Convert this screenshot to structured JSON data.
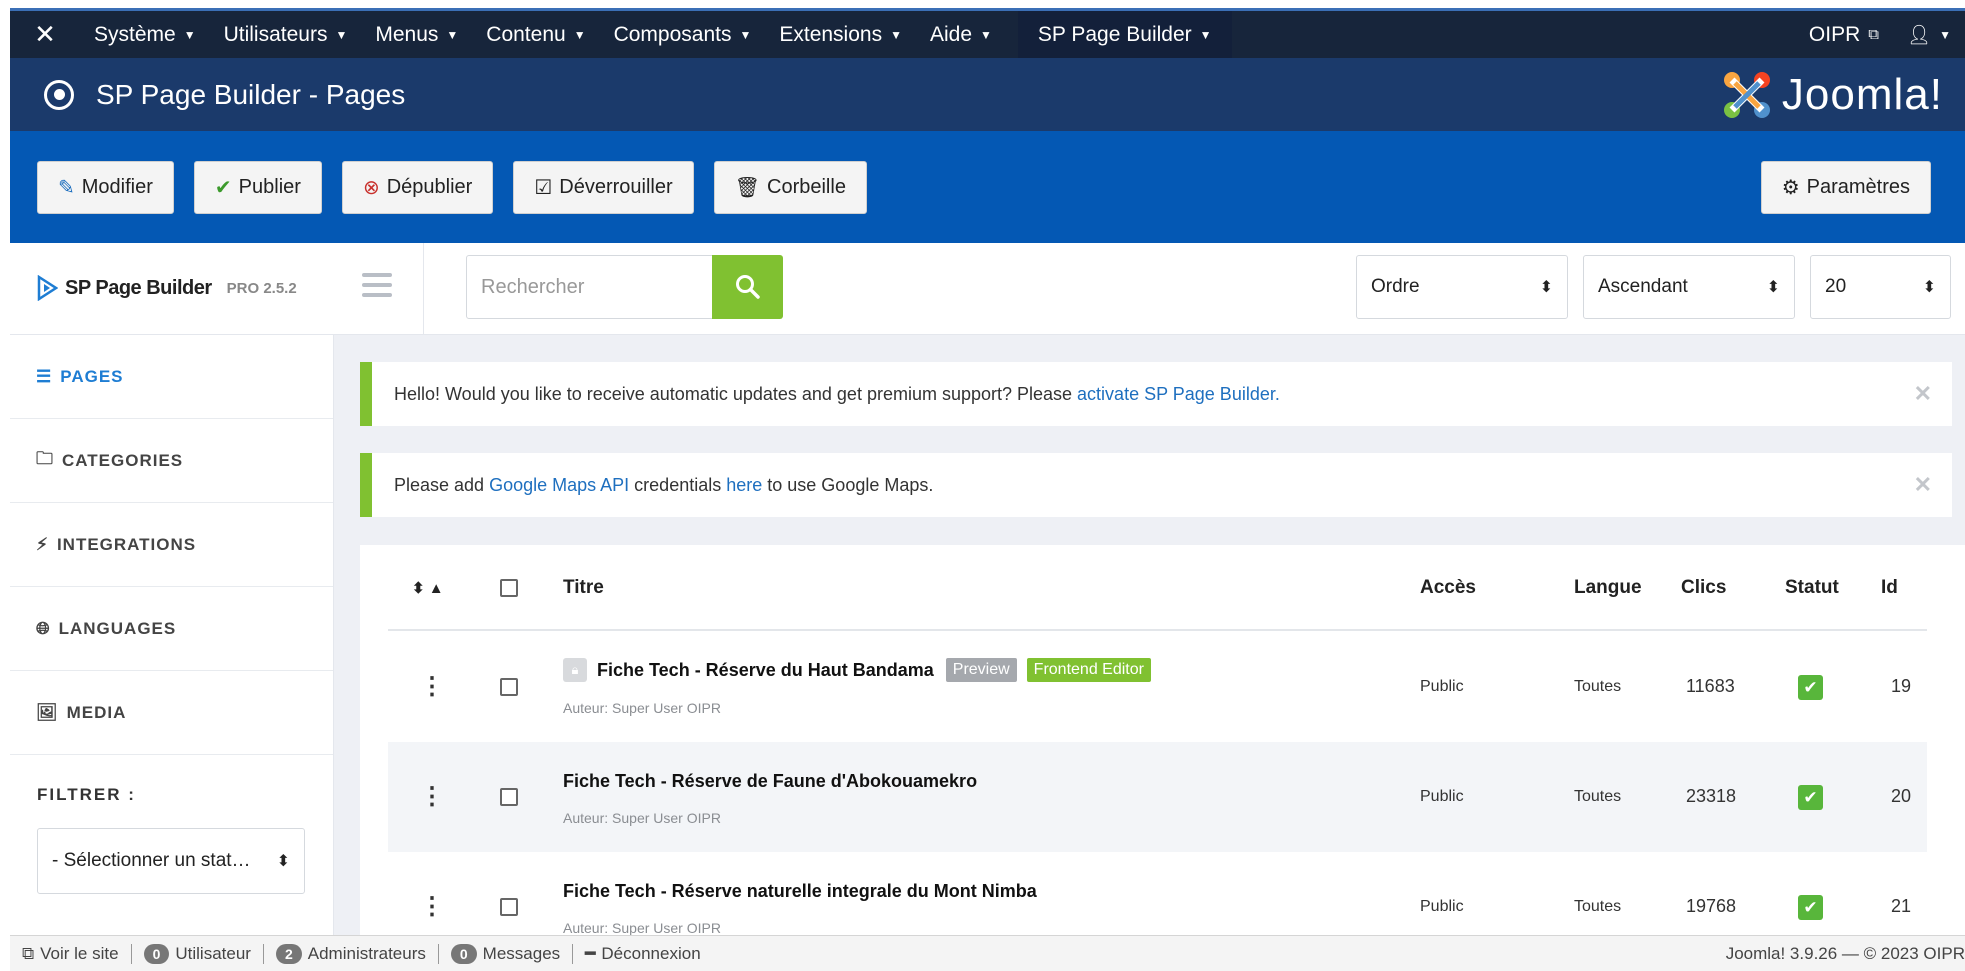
{
  "topbar": {
    "menu": [
      "Système",
      "Utilisateurs",
      "Menus",
      "Contenu",
      "Composants",
      "Extensions",
      "Aide"
    ],
    "sp_menu": "SP Page Builder",
    "site_link": "OIPR"
  },
  "header": {
    "title": "SP Page Builder - Pages",
    "brand": "Joomla!"
  },
  "toolbar": {
    "edit": "Modifier",
    "publish": "Publier",
    "unpublish": "Dépublier",
    "unlock": "Déverrouiller",
    "trash": "Corbeille",
    "settings": "Paramètres"
  },
  "sp": {
    "brand": "SP Page Builder",
    "version": "PRO 2.5.2"
  },
  "search": {
    "placeholder": "Rechercher"
  },
  "sort": {
    "field": "Ordre",
    "direction": "Ascendant",
    "limit": "20"
  },
  "sidebar": {
    "items": [
      "PAGES",
      "CATEGORIES",
      "INTEGRATIONS",
      "LANGUAGES",
      "MEDIA"
    ],
    "filter_title": "FILTRER :",
    "status_select": "- Sélectionner un stat…"
  },
  "alerts": {
    "update_text": "Hello! Would you like to receive automatic updates and get premium support? Please ",
    "update_link": "activate SP Page Builder.",
    "maps_pre": "Please add ",
    "maps_link1": "Google Maps API",
    "maps_mid": " credentials ",
    "maps_link2": "here",
    "maps_post": " to use Google Maps."
  },
  "table": {
    "headers": {
      "title": "Titre",
      "access": "Accès",
      "language": "Langue",
      "clicks": "Clics",
      "status": "Statut",
      "id": "Id"
    },
    "preview_label": "Preview",
    "frontend_label": "Frontend Editor",
    "rows": [
      {
        "title": "Fiche Tech - Réserve du Haut Bandama",
        "author": "Auteur: Super User OIPR",
        "access": "Public",
        "language": "Toutes",
        "clicks": "11683",
        "id": "19"
      },
      {
        "title": "Fiche Tech - Réserve de Faune d'Abokouamekro",
        "author": "Auteur: Super User OIPR",
        "access": "Public",
        "language": "Toutes",
        "clicks": "23318",
        "id": "20"
      },
      {
        "title": "Fiche Tech - Réserve naturelle integrale du Mont Nimba",
        "author": "Auteur: Super User OIPR",
        "access": "Public",
        "language": "Toutes",
        "clicks": "19768",
        "id": "21"
      }
    ]
  },
  "statusbar": {
    "view_site": "Voir le site",
    "visitors_count": "0",
    "visitors_label": "Utilisateur",
    "admins_count": "2",
    "admins_label": "Administrateurs",
    "messages_count": "0",
    "messages_label": "Messages",
    "logout": "Déconnexion",
    "version": "Joomla! 3.9.26  —  © 2023 OIPR"
  },
  "colors": {
    "topbar": "#17253b",
    "header": "#1b3a6b",
    "toolbar": "#0458b4",
    "accent_green": "#80c131",
    "link_blue": "#1e6fbf"
  }
}
